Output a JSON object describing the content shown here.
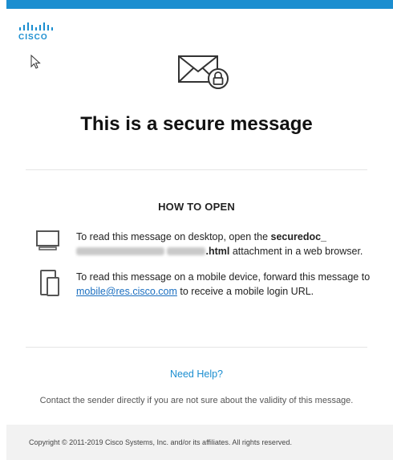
{
  "colors": {
    "accent": "#1b8ed0",
    "link": "#1b6fc0",
    "footer_bg": "#f2f2f2"
  },
  "brand": {
    "logo_text": "CISCO"
  },
  "icons": {
    "envelope": "envelope-lock-icon",
    "desktop": "desktop-monitor-icon",
    "mobile": "mobile-device-icon",
    "cursor": "mouse-cursor-icon"
  },
  "headline": "This is a secure message",
  "how_to_open": {
    "title": "HOW TO OPEN",
    "desktop": {
      "text_before": "To read this message on desktop, open the ",
      "filename_prefix": "securedoc_",
      "filename_suffix": ".html",
      "text_after": " attachment in a web browser."
    },
    "mobile": {
      "text_before": "To read this message on a mobile device, forward this message to ",
      "email": "mobile@res.cisco.com",
      "text_after": " to receive a mobile login URL."
    }
  },
  "help": {
    "title": "Need Help?",
    "text": "Contact the sender directly if you are not sure about the validity of this message."
  },
  "footer": {
    "copyright": "Copyright © 2011-2019 Cisco Systems, Inc. and/or its affiliates. All rights reserved."
  }
}
